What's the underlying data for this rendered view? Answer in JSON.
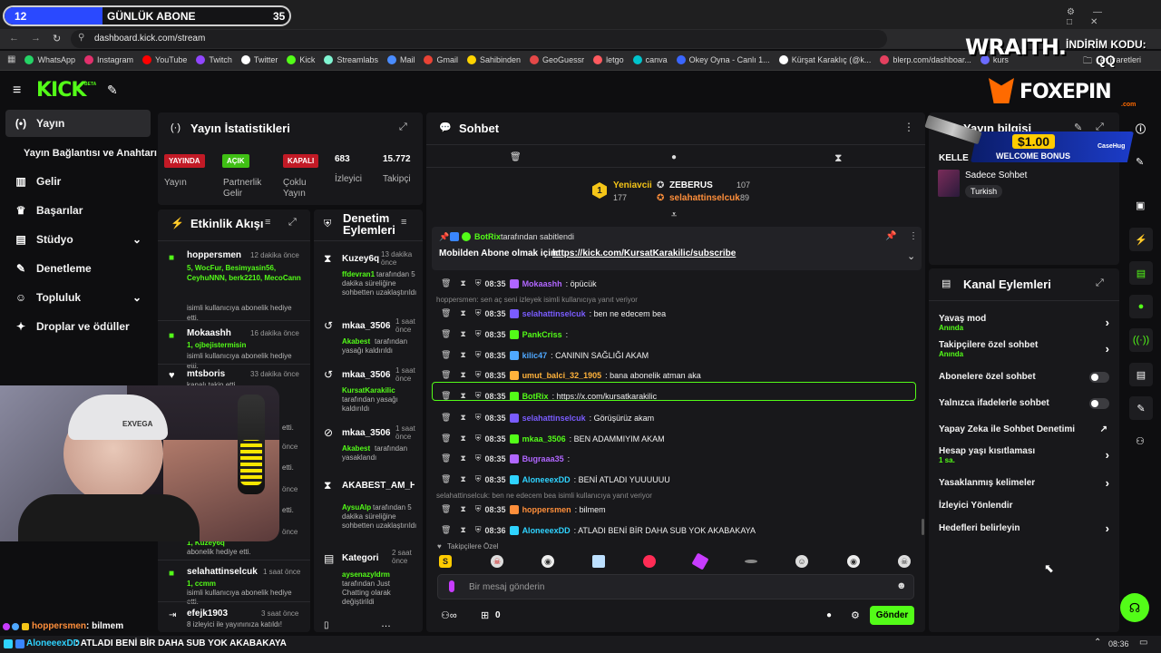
{
  "overlay": {
    "sub_goal_count": "12",
    "sub_goal_label": "GÜNLÜK ABONE",
    "sub_goal_target": "35",
    "wraith_brand": "WRAITH.",
    "promo_label": "İNDİRİM KODU:",
    "promo_code": "QQ",
    "foxepin_brand": "FOXEPIN",
    "foxepin_sub": ".com",
    "ad_amount": "$1.00",
    "ad_text": "WELCOME BONUS",
    "ad_brand": "CaseHug",
    "webcam_cap_text": "EXVEGA",
    "bottom_ticker_user1": "hoppersmen",
    "bottom_ticker_msg1": ": bilmem",
    "bottom_ticker_user2": "AloneeexDD",
    "bottom_ticker_msg2": ": ATLADI BENİ BİR DAHA SUB YOK AKABAKAYA"
  },
  "browser": {
    "url": "dashboard.kick.com/stream",
    "bookmarks": [
      "WhatsApp",
      "Instagram",
      "YouTube",
      "Twitch",
      "Twitter",
      "Kick",
      "Streamlabs",
      "Mail",
      "Gmail",
      "Sahibinden",
      "GeoGuessr",
      "letgo",
      "canva",
      "Okey Oyna - Canlı 1...",
      "Kürşat Karaklıç (@k...",
      "blerp.com/dashboar...",
      "kurs"
    ],
    "bookmarks_folder": "er İşaretleri",
    "bookmark_colors": [
      "#25d366",
      "#e1306c",
      "#ff0000",
      "#9146ff",
      "#ffffff",
      "#53fc18",
      "#80f5d2",
      "#4a8cff",
      "#ea4335",
      "#ffd400",
      "#e54848",
      "#ff5a5f",
      "#00c4cc",
      "#3a66ff",
      "#ffffff",
      "#e4405f",
      "#6b6bff"
    ],
    "clock": "08:36"
  },
  "nav": {
    "logo": "KICK",
    "logo_beta": "BETA",
    "items": [
      {
        "label": "Yayın",
        "icon": "broadcast-icon"
      },
      {
        "label": "Yayın Bağlantısı ve Anahtarı",
        "icon": ""
      },
      {
        "label": "Gelir",
        "icon": "chart-icon"
      },
      {
        "label": "Başarılar",
        "icon": "trophy-icon"
      },
      {
        "label": "Stüdyo",
        "icon": "grid-icon"
      },
      {
        "label": "Denetleme",
        "icon": "wrench-icon"
      },
      {
        "label": "Topluluk",
        "icon": "community-icon"
      },
      {
        "label": "Droplar ve ödüller",
        "icon": "gift-icon"
      }
    ]
  },
  "stats": {
    "title": "Yayın İstatistikleri",
    "live_badge": "YAYINDA",
    "live_label": "Yayın",
    "partner_badge": "AÇIK",
    "partner_label": "Partnerlik Gelir Programı",
    "multi_badge": "KAPALI",
    "multi_label": "Çoklu Yayın",
    "viewers": "683",
    "viewers_label": "İzleyici",
    "followers": "15.772",
    "followers_label": "Takipçi"
  },
  "activity": {
    "title": "Etkinlik Akışı",
    "items": [
      {
        "user": "hoppersmen",
        "time": "12 dakika önce",
        "green": "5, WocFur, Besimyasin56, CeyhuNNN, berk2210, MecoCann",
        "desc": "isimli kullanıcıya abonelik hediye etti."
      },
      {
        "user": "Mokaashh",
        "time": "16 dakika önce",
        "green": "1, ojbejistermisin",
        "desc": "isimli kullanıcıya abonelik hediye etti."
      },
      {
        "user": "mtsboris",
        "time": "33 dakika önce",
        "green": "",
        "desc": "kanalı takip etti"
      },
      {
        "user": "selahattinselcuk",
        "time": "1 saat önce",
        "green": "1, ccmm",
        "desc": "isimli kullanıcıya abonelik hediye etti."
      },
      {
        "user": "efejk1903",
        "time": "3 saat önce",
        "green": "",
        "desc": "8 izleyici ile yayınınıza katıldı!"
      }
    ],
    "partial_green": "1, Kuzey6q",
    "partial_desc": "abonelik hediye etti.",
    "partial_suffix_1": "etti.",
    "partial_suffix_2": "önce"
  },
  "moderation": {
    "title": "Denetim Eylemleri",
    "items": [
      {
        "user": "Kuzey6q",
        "time": "13 dakika önce",
        "green": "ffdevran1",
        "desc": "tarafından 5 dakika süreliğine sohbetten uzaklaştırıldı"
      },
      {
        "user": "mkaa_3506",
        "time": "1 saat önce",
        "green": "Akabest",
        "desc": "tarafından yasağı kaldırıldı"
      },
      {
        "user": "mkaa_3506",
        "time": "1 saat önce",
        "green": "KursatKarakilic",
        "desc": "tarafından yasağı kaldırıldı"
      },
      {
        "user": "mkaa_3506",
        "time": "1 saat önce",
        "green": "Akabest",
        "desc": "tarafından yasaklandı"
      },
      {
        "user": "AKABEST_AM_HA",
        "time": "",
        "green": "AysuAlp",
        "desc": "tarafından 5 dakika süreliğine sohbetten uzaklaştırıldı"
      },
      {
        "user": "Kategori",
        "time": "2 saat önce",
        "green": "aysenazyldrm",
        "desc": "tarafından Just Chatting olarak değiştirildi"
      }
    ]
  },
  "chat": {
    "title": "Sohbet",
    "top_gifters": [
      {
        "rank": "1",
        "name": "Yeniavcii",
        "value": "177"
      },
      {
        "name": "ZEBERUS",
        "value": "107"
      },
      {
        "name": "selahattinselcuk",
        "value": "89"
      }
    ],
    "pinned_by": "BotRix",
    "pinned_suffix": "tarafından sabitlendi",
    "pinned_text": "Mobilden Abone olmak için:",
    "pinned_link": "https://kick.com/KursatKarakilic/subscribe",
    "messages": [
      {
        "time": "08:35",
        "user": "Mokaashh",
        "color": "#b066ff",
        "text": ": öpücük",
        "reply": ""
      },
      {
        "time": "08:35",
        "user": "selahattinselcuk",
        "color": "#7a5cff",
        "text": ": ben ne edecem bea",
        "reply": "hoppersmen: sen aç seni izleyek isimli kullanıcıya yanıt veriyor"
      },
      {
        "time": "08:35",
        "user": "PankCriss",
        "color": "#53fc18",
        "text": ":",
        "reply": ""
      },
      {
        "time": "08:35",
        "user": "kilic47",
        "color": "#4fa8ff",
        "text": ": CANININ SAĞLIĞI AKAM",
        "reply": ""
      },
      {
        "time": "08:35",
        "user": "umut_balci_32_1905",
        "color": "#ffb23b",
        "text": ": bana abonelik atman aka",
        "reply": ""
      },
      {
        "time": "08:35",
        "user": "BotRix",
        "color": "#53fc18",
        "text": ": https://x.com/kursatkarakilic",
        "reply": ""
      },
      {
        "time": "08:35",
        "user": "selahattinselcuk",
        "color": "#7a5cff",
        "text": ": Görüşürüz akam",
        "reply": ""
      },
      {
        "time": "08:35",
        "user": "mkaa_3506",
        "color": "#53fc18",
        "text": ": BEN ADAMMIYIM AKAM",
        "reply": ""
      },
      {
        "time": "08:35",
        "user": "Bugraaa35",
        "color": "#b066ff",
        "text": ":",
        "reply": ""
      },
      {
        "time": "08:35",
        "user": "AloneeexDD",
        "color": "#2fd3ff",
        "text": ": BENİ ATLADI YUUUUUU",
        "reply": ""
      },
      {
        "time": "08:35",
        "user": "hoppersmen",
        "color": "#ff8f3b",
        "text": ": bilmem",
        "reply": "selahattinselcuk: ben ne edecem bea isimli kullanıcıya yanıt veriyor"
      },
      {
        "time": "08:36",
        "user": "AloneeexDD",
        "color": "#2fd3ff",
        "text": ": ATLADI BENİ BİR DAHA SUB YOK AKABAKAYA",
        "reply": ""
      }
    ],
    "followers_only": "Takipçilere Özel",
    "input_placeholder": "Bir mesaj gönderin",
    "points": "0",
    "send_label": "Gönder"
  },
  "stream_info": {
    "title": "Yayın bilgisi",
    "category_prefix": "KELLE",
    "category_tag": "Sadece Sohbet",
    "language": "Turkish"
  },
  "channel_actions": {
    "title": "Kanal Eylemleri",
    "items": [
      {
        "label": "Yavaş mod",
        "sub": "Anında",
        "control": "chevron"
      },
      {
        "label": "Takipçilere özel sohbet",
        "sub": "Anında",
        "control": "chevron"
      },
      {
        "label": "Abonelere özel sohbet",
        "sub": "",
        "control": "toggle"
      },
      {
        "label": "Yalnızca ifadelerle sohbet",
        "sub": "",
        "control": "toggle"
      },
      {
        "label": "Yapay Zeka ile Sohbet Denetimi",
        "sub": "",
        "control": "external"
      },
      {
        "label": "Hesap yaşı kısıtlaması",
        "sub": "1 sa.",
        "control": "chevron"
      },
      {
        "label": "Yasaklanmış kelimeler",
        "sub": "",
        "control": "chevron"
      },
      {
        "label": "İzleyici Yönlendir",
        "sub": "",
        "control": "none"
      },
      {
        "label": "Hedefleri belirleyin",
        "sub": "",
        "control": "chevron"
      }
    ]
  }
}
